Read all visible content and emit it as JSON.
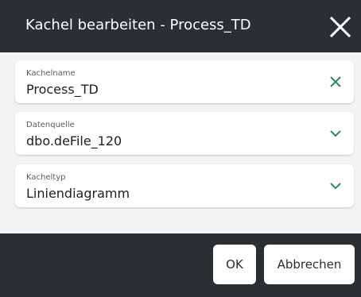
{
  "dialog": {
    "title": "Kachel bearbeiten - Process_TD",
    "close_icon": "close-icon"
  },
  "fields": [
    {
      "label": "Kachelname",
      "value": "Process_TD",
      "icon": "clear-icon",
      "icon_color": "#2e8b57"
    },
    {
      "label": "Datenquelle",
      "value": "dbo.deFile_120",
      "icon": "chevron-down-icon",
      "icon_color": "#2e8b57"
    },
    {
      "label": "Kacheltyp",
      "value": "Liniendiagramm",
      "icon": "chevron-down-icon",
      "icon_color": "#2e8b57"
    }
  ],
  "buttons": {
    "ok_label": "OK",
    "cancel_label": "Abbrechen"
  },
  "colors": {
    "header_bg": "#2b2f32",
    "body_bg": "#f3f3f3",
    "accent": "#2e8b57"
  }
}
